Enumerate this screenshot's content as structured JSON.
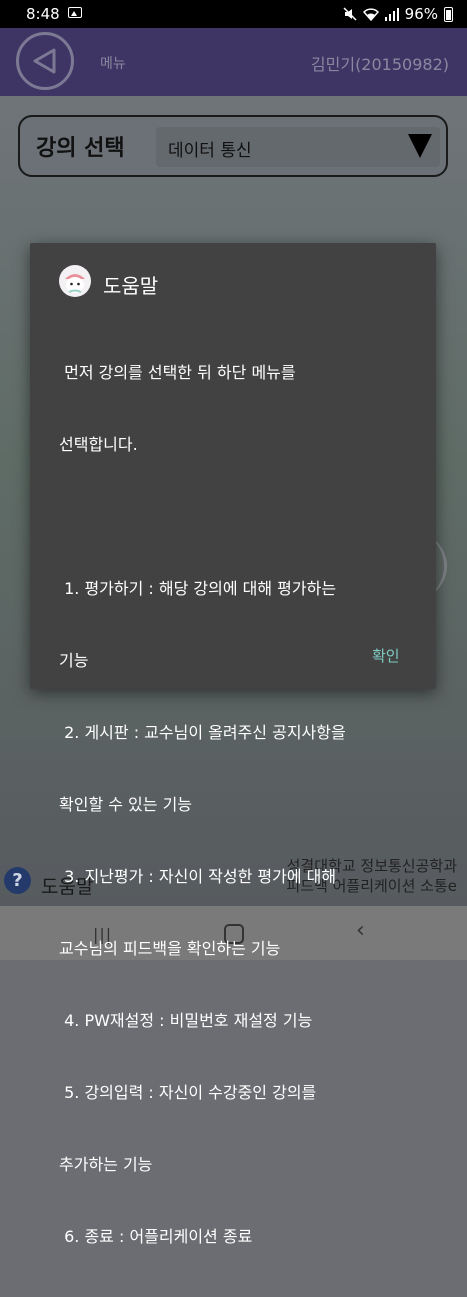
{
  "status_bar": {
    "time": "8:48",
    "battery": "96%"
  },
  "header": {
    "menu_label": "메뉴",
    "user_label": "김민기(20150982)"
  },
  "course": {
    "label": "강의 선택",
    "selected": "데이터 통신"
  },
  "dialog": {
    "title": "도움말",
    "lines": [
      " 먼저 강의를 선택한 뒤 하단 메뉴를",
      "선택합니다.",
      "",
      " 1. 평가하기 : 해당 강의에 대해 평가하는",
      "기능",
      " 2. 게시판 : 교수님이 올려주신 공지사항을",
      "확인할 수 있는 기능",
      " 3. 지난평가 : 자신이 작성한 평가에 대해",
      "교수님의 피드백을 확인하는 기능",
      " 4. PW재설정 : 비밀번호 재설정 기능",
      " 5. 강의입력 : 자신이 수강중인 강의를",
      "추가하는 기능",
      " 6. 종료 : 어플리케이션 종료"
    ],
    "ok_label": "확인"
  },
  "footer": {
    "help_label": "도움말",
    "school_line1": "성결대학교 정보통신공학과",
    "school_line2": "피드백 어플리케이션 소통e"
  },
  "icons": [
    "image-icon",
    "mute-icon",
    "wifi-icon",
    "signal-icon",
    "battery-icon",
    "back-arrow-icon",
    "dropdown-arrow-icon",
    "help-icon",
    "recent-apps-icon",
    "home-icon",
    "nav-back-icon"
  ]
}
